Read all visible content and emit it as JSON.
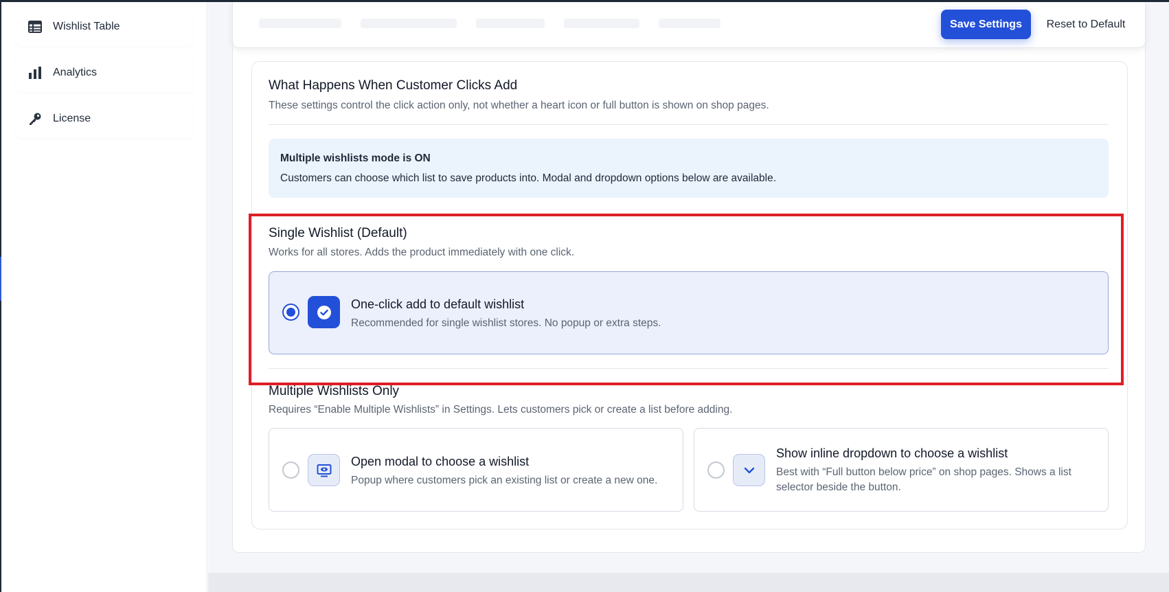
{
  "sidebar": {
    "items": [
      {
        "label": "Wishlist Table",
        "icon": "table-icon"
      },
      {
        "label": "Analytics",
        "icon": "bar-chart-icon"
      },
      {
        "label": "License",
        "icon": "key-icon"
      }
    ]
  },
  "toolbar": {
    "save_label": "Save Settings",
    "reset_label": "Reset to Default"
  },
  "section": {
    "title": "What Happens When Customer Clicks Add",
    "description": "These settings control the click action only, not whether a heart icon or full button is shown on shop pages."
  },
  "notice": {
    "title": "Multiple wishlists mode is ON",
    "text": "Customers can choose which list to save products into. Modal and dropdown options below are available."
  },
  "single": {
    "title": "Single Wishlist (Default)",
    "description": "Works for all stores. Adds the product immediately with one click.",
    "option": {
      "title": "One-click add to default wishlist",
      "description": "Recommended for single wishlist stores. No popup or extra steps.",
      "selected": true
    }
  },
  "multiple": {
    "title": "Multiple Wishlists Only",
    "description": "Requires “Enable Multiple Wishlists” in Settings. Lets customers pick or create a list before adding.",
    "options": [
      {
        "title": "Open modal to choose a wishlist",
        "description": "Popup where customers pick an existing list or create a new one.",
        "icon": "modal-icon",
        "selected": false
      },
      {
        "title": "Show inline dropdown to choose a wishlist",
        "description_line1": "Best with “Full button below price” on shop pages. Shows a list",
        "description_line2": "selector beside the button.",
        "icon": "chevron-down-icon",
        "selected": false
      }
    ]
  },
  "colors": {
    "accent": "#2350d8",
    "highlight": "#dd1f26",
    "notice_bg": "#ebf3fd",
    "selected_bg": "#ecf0fc"
  }
}
